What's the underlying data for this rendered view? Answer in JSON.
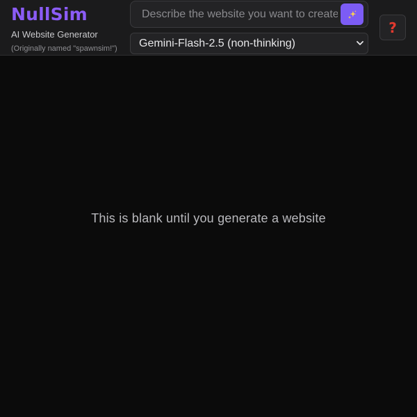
{
  "brand": {
    "title": "NullSim",
    "subtitle": "AI Website Generator",
    "note": "(Originally named \"spawnsim!\")",
    "accent_color": "#8b5cf6"
  },
  "prompt": {
    "placeholder": "Describe the website you want to create",
    "value": "",
    "generate_icon": "sparkles-icon",
    "generate_button_color": "#7c5cf5"
  },
  "model_select": {
    "selected": "Gemini-Flash-2.5 (non-thinking)",
    "icon": "chevron-down-icon"
  },
  "help_button": {
    "glyph": "?",
    "icon": "question-mark-icon",
    "color": "#e23a2f"
  },
  "main": {
    "blank_message": "This is blank until you generate a website"
  }
}
